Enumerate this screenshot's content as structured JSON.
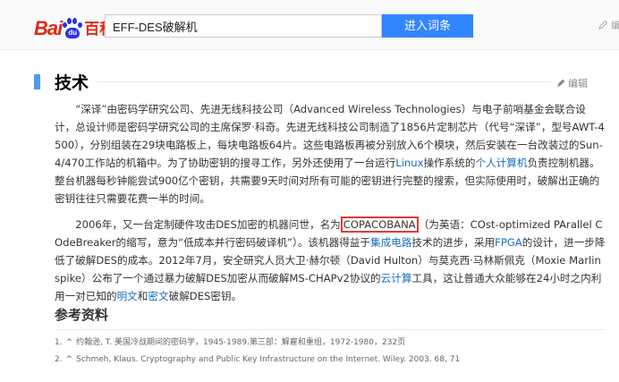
{
  "header": {
    "logo_bai": "Bai",
    "logo_du": "du",
    "logo_baike": "百科",
    "search_value": "EFF-DES破解机",
    "search_button": "进入词条",
    "edit_label": "编"
  },
  "section": {
    "title": "技术",
    "edit_label": "编辑"
  },
  "paragraph1": {
    "t1": "“深译”由密码学研究公司、先进无线科技公司（Advanced Wireless Technologies）与电子前哨基金会联合设计，总设计师是密码学研究公司的主席保罗·科奇。先进无线科技公司制造了1856片定制芯片（代号“深译”，型号AWT-4500），分别组装在29块电路板上，每块电路板64片。这些电路板再被分别放入6个模块，然后安装在一台改装过的Sun-4/470工作站的机箱中。为了协助密钥的搜寻工作，另外还使用了一台运行",
    "link_linux": "Linux",
    "t2": "操作系统的",
    "link_pc": "个人计算机",
    "t3": "负责控制机器。整台机器每秒钟能尝试900亿个密钥，共需要9天时间对所有可能的密钥进行完整的搜索，但实际使用时，破解出正确的密钥往往只需要花费一半的时间。"
  },
  "paragraph2": {
    "t1": "2006年，又一台定制硬件攻击DES加密的机器问世，名为",
    "boxed": "COPACOBANA",
    "t2": "（为英语：COst-optimized PArallel COdeBreaker的缩写，意为“低成本并行密码破译机”）。该机器得益于",
    "link_ic": "集成电路",
    "t3": "技术的进步，采用",
    "link_fpga": "FPGA",
    "t4": "的设计，进一步降低了破解DES的成本。2012年7月，安全研究人员大卫·赫尔顿（David Hulton）与莫克西·马林斯佩克（Moxie Marlinspike）公布了一个通过暴力破解DES加密从而破解MS-CHAPv2协议的",
    "link_cloud": "云计算",
    "t5": "工具，这让普通大众能够在24小时之内利用一对已知的",
    "link_plain": "明文",
    "t6": "和",
    "link_cipher": "密文",
    "t7": "破解DES密钥。"
  },
  "references": {
    "title": "参考资料",
    "items": [
      {
        "num": "1.",
        "caret": "^",
        "text": "约翰逊, T. 美国冷战期间的密码学，1945-1989.第三部：解雇和重组，1972-1980，232页"
      },
      {
        "num": "2.",
        "caret": "^",
        "text": "Schmeh, Klaus. Cryptography and Public Key Infrastructure on the Internet. Wiley. 2003. 68, 71"
      }
    ]
  }
}
